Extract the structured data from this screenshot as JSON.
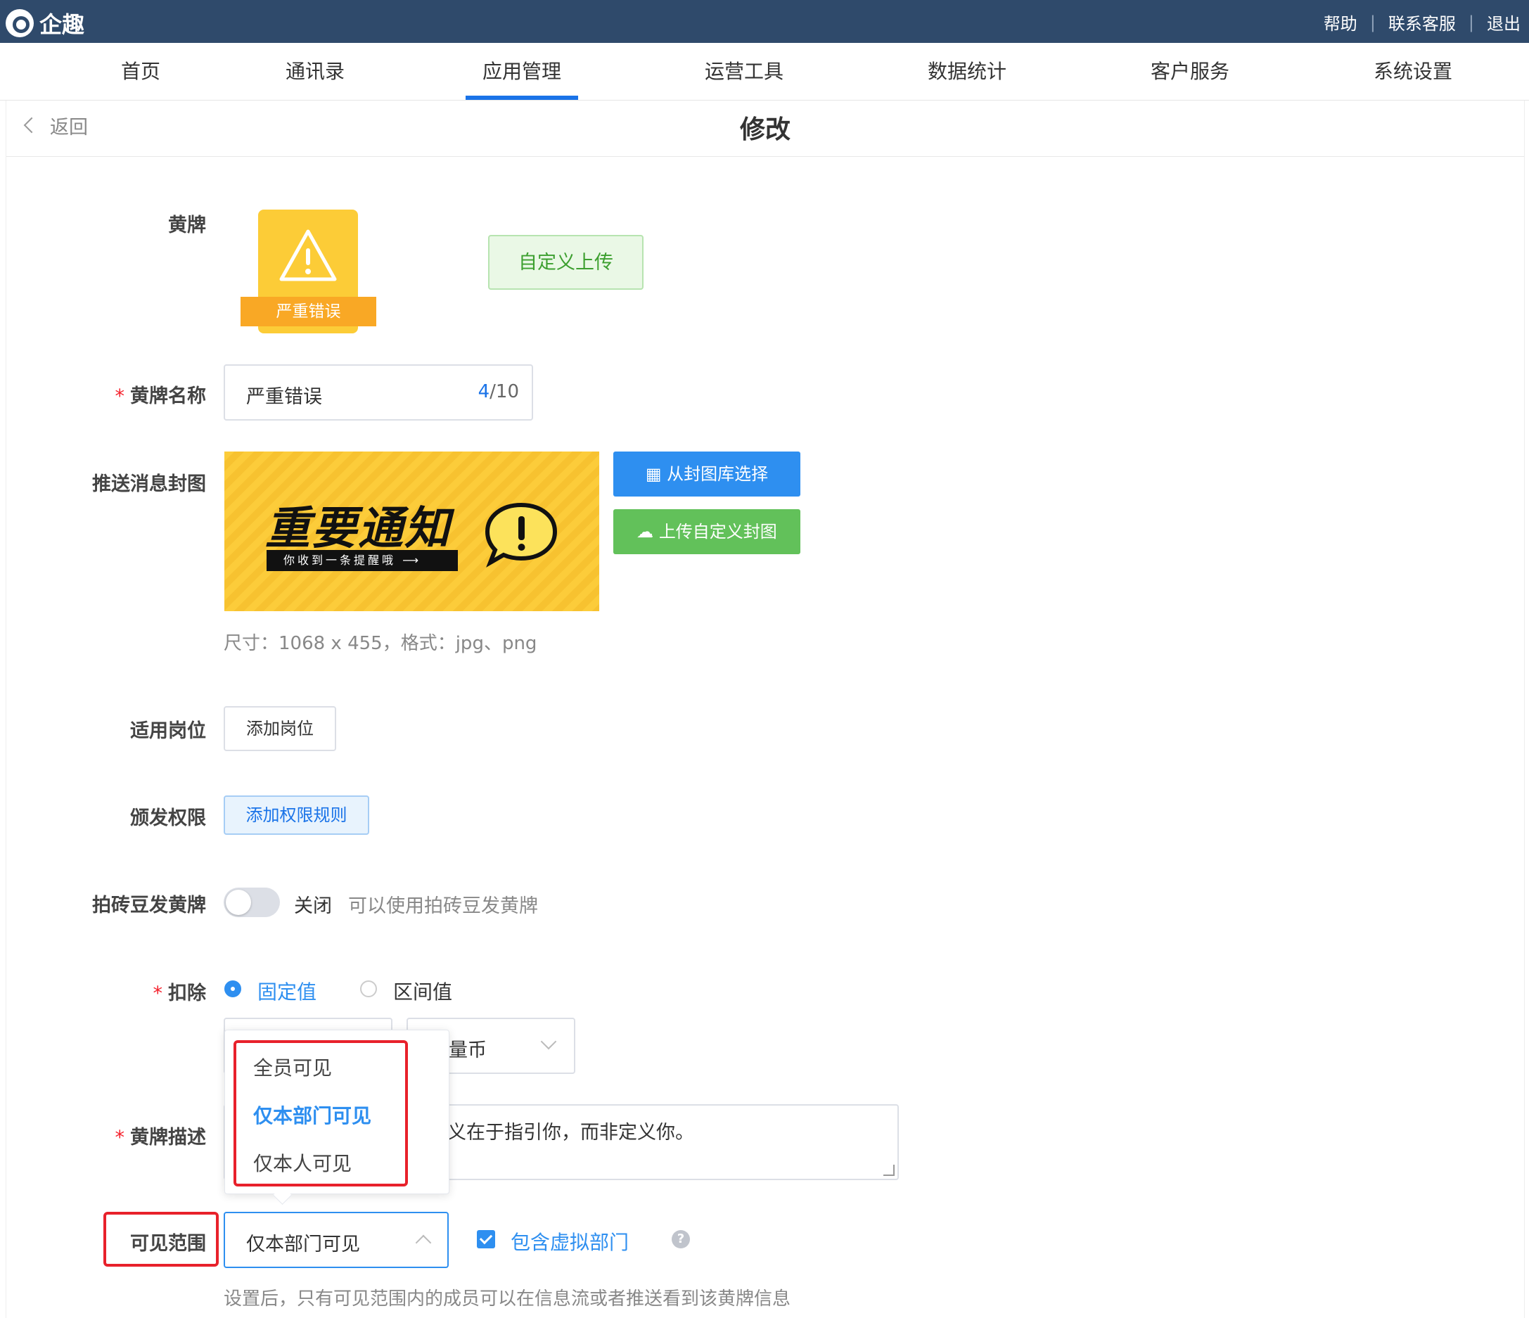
{
  "topbar": {
    "logo_text": "企趣",
    "links": [
      "帮助",
      "联系客服",
      "退出"
    ]
  },
  "nav": {
    "items": [
      "首页",
      "通讯录",
      "应用管理",
      "运营工具",
      "数据统计",
      "客户服务",
      "系统设置"
    ],
    "active_index": 2
  },
  "page": {
    "back_label": "返回",
    "title": "修改"
  },
  "form": {
    "badge": {
      "label": "黄牌",
      "ribbon_text": "严重错误",
      "custom_upload": "自定义上传"
    },
    "name": {
      "label": "黄牌名称",
      "value": "严重错误",
      "count_current": "4",
      "count_max": "/10"
    },
    "cover": {
      "label": "推送消息封图",
      "title_text": "重要通知",
      "bar_text": "你收到一条提醒哦",
      "pick_button": "从封图库选择",
      "upload_button": "上传自定义封图",
      "hint": "尺寸：1068 x 455，格式：jpg、png"
    },
    "position": {
      "label": "适用岗位",
      "button": "添加岗位"
    },
    "permission": {
      "label": "颁发权限",
      "button": "添加权限规则"
    },
    "brick": {
      "label": "拍砖豆发黄牌",
      "state": "关闭",
      "desc": "可以使用拍砖豆发黄牌"
    },
    "deduct": {
      "label": "扣除",
      "options": [
        "固定值",
        "区间值"
      ],
      "selected_index": 0,
      "unit": "量币"
    },
    "description": {
      "label": "黄牌描述",
      "value": "义在于指引你，而非定义你。"
    },
    "visibility": {
      "label": "可见范围",
      "value": "仅本部门可见",
      "options": [
        "全员可见",
        "仅本部门可见",
        "仅本人可见"
      ],
      "selected_index": 1,
      "include_virtual": "包含虚拟部门",
      "help_symbol": "?",
      "hint": "设置后，只有可见范围内的成员可以在信息流或者推送看到该黄牌信息"
    }
  },
  "colors": {
    "topbar": "#2f4a6b",
    "accent": "#2e8ff0",
    "highlight_box": "#e8212b",
    "badge_yellow": "#fccc37"
  }
}
